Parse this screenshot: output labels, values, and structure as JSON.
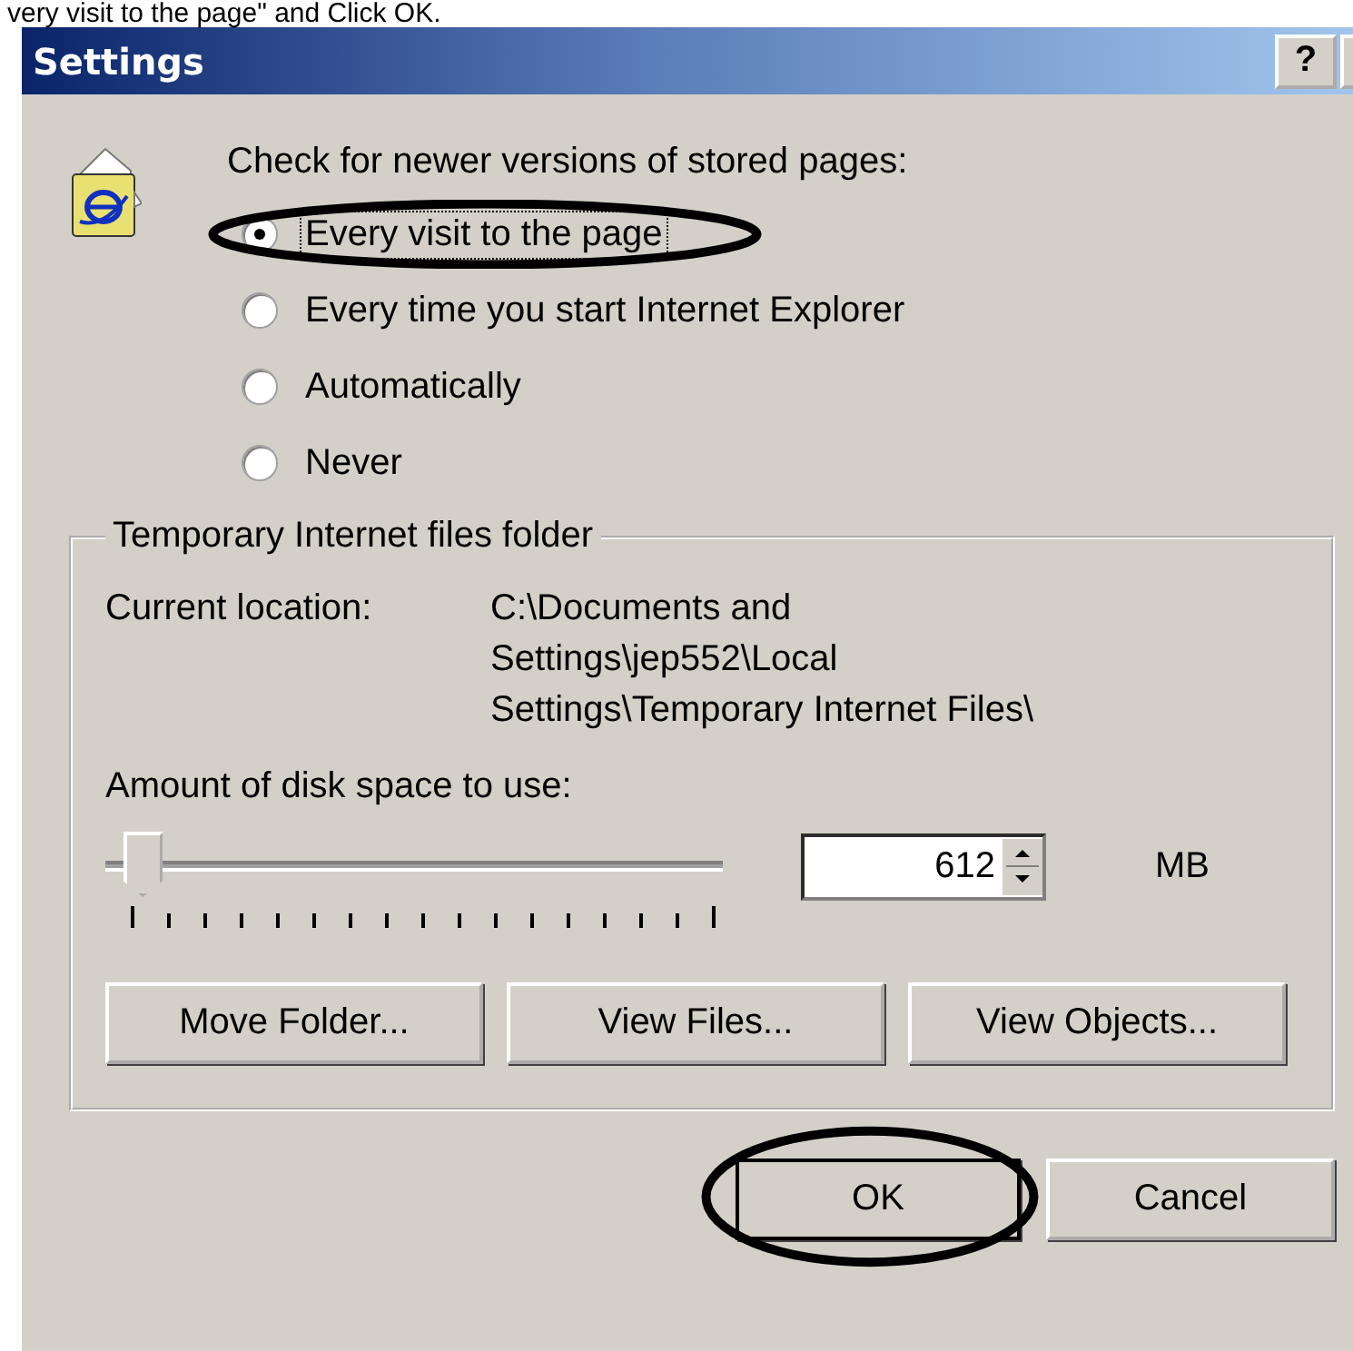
{
  "caption": "very visit to the page\" and Click OK.",
  "window": {
    "title": "Settings",
    "help_button": "?"
  },
  "check_label": "Check for newer versions of stored pages:",
  "options": [
    {
      "label": "Every visit to the page",
      "selected": true,
      "focused": true,
      "circled": true
    },
    {
      "label": "Every time you start Internet Explorer",
      "selected": false,
      "focused": false,
      "circled": false
    },
    {
      "label": "Automatically",
      "selected": false,
      "focused": false,
      "circled": false
    },
    {
      "label": "Never",
      "selected": false,
      "focused": false,
      "circled": false
    }
  ],
  "group": {
    "title": "Temporary Internet files folder",
    "location_label": "Current location:",
    "location_lines": [
      "C:\\Documents and",
      "Settings\\jep552\\Local",
      "Settings\\Temporary Internet Files\\"
    ],
    "disk_label": "Amount of disk space to use:",
    "slider": {
      "level": 0.03
    },
    "size": {
      "value": "612"
    },
    "unit": "MB",
    "buttons": [
      "Move Folder...",
      "View Files...",
      "View Objects..."
    ]
  },
  "buttons": [
    {
      "label": "OK",
      "circled": true
    },
    {
      "label": "Cancel",
      "circled": false
    }
  ]
}
